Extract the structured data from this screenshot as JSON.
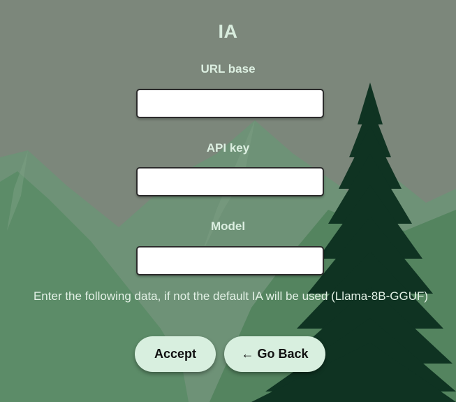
{
  "colors": {
    "background": "#7c877b",
    "mountain_far": "#6e9277",
    "mountain_near": "#5a8a67",
    "tree": "#0f3322",
    "text_light": "#dcefe1",
    "button_bg": "#d8efdf",
    "input_bg": "#ffffff"
  },
  "page": {
    "title": "IA"
  },
  "form": {
    "url_base": {
      "label": "URL base",
      "value": "",
      "placeholder": ""
    },
    "api_key": {
      "label": "API key",
      "value": "",
      "placeholder": ""
    },
    "model": {
      "label": "Model",
      "value": "",
      "placeholder": ""
    }
  },
  "info_text": "Enter the following data, if not the default IA will be used (Llama-8B-GGUF)",
  "buttons": {
    "accept": "Accept",
    "back": "← Go Back"
  },
  "background_icons": {
    "mountains": "mountain-range-illustration",
    "tree": "pine-tree-illustration"
  }
}
